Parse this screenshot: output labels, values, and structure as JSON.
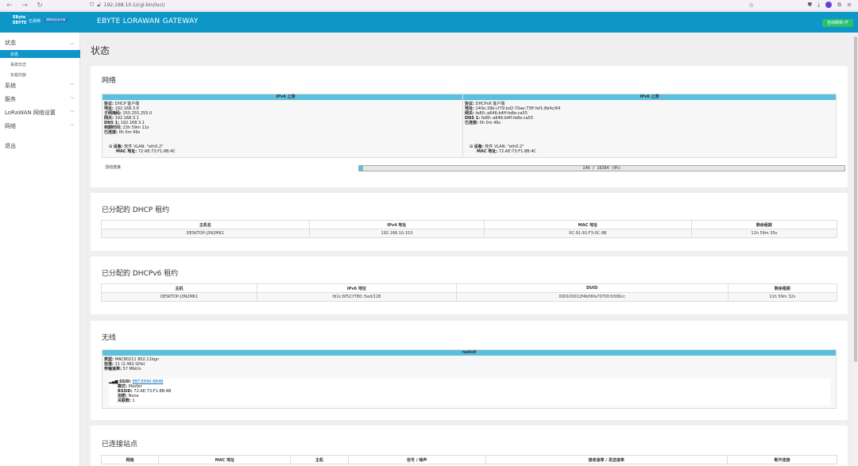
{
  "browser": {
    "url": "192.168.10.1/cgi-bin/luci/"
  },
  "header": {
    "logo_line1": "EByte",
    "logo_line2": "EBYTE",
    "logo_cn": "亿佰特",
    "logo_badge": "物联网应用专家",
    "title": "EBYTE LORAWAN GATEWAY",
    "auto_refresh": "自动刷新:开"
  },
  "sidebar": {
    "status": "状态",
    "status_items": [
      "状态",
      "系统日志",
      "负载均衡"
    ],
    "system": "系统",
    "services": "服务",
    "lorawan": "LoRaWAN 网络设置",
    "network": "网络",
    "logout": "退出"
  },
  "page_title": "状态",
  "network": {
    "title": "网络",
    "ipv4": {
      "header": "IPv4 上游",
      "lines": [
        {
          "k": "协议:",
          "v": "DHCP 客户端"
        },
        {
          "k": "地址:",
          "v": "192.168.3.8"
        },
        {
          "k": "子网掩码:",
          "v": "255.255.255.0"
        },
        {
          "k": "网关:",
          "v": "192.168.3.1"
        },
        {
          "k": "DNS 1:",
          "v": "192.168.3.1"
        },
        {
          "k": "到期时间:",
          "v": "23h 59m 11s"
        },
        {
          "k": "已连接:",
          "v": "0h 0m 49s"
        }
      ],
      "device_label": "设备:",
      "device_value": "软件 VLAN: \"eth0.2\"",
      "mac_label": "MAC 地址:",
      "mac_value": "72:AE:73:F1:8B:4C"
    },
    "ipv6": {
      "header": "IPv6 上游",
      "lines": [
        {
          "k": "协议:",
          "v": "DHCPv6 客户端"
        },
        {
          "k": "地址:",
          "v": "240e:39b:cf79:bd2:70ae:73ff:fef1:8b4c/64"
        },
        {
          "k": "网关:",
          "v": "fe80::a646:b4ff:fe8e:ca55"
        },
        {
          "k": "DNS 1:",
          "v": "fe80::a646:b4ff:fe8e:ca55"
        },
        {
          "k": "已连接:",
          "v": "0h 0m 46s"
        }
      ],
      "device_label": "设备:",
      "device_value": "软件 VLAN: \"eth0.2\"",
      "mac_label": "MAC 地址:",
      "mac_value": "72:AE:73:F1:8B:4C"
    },
    "active_conn_label": "活动连接",
    "active_conn_value": "149 / 16384 (0%)",
    "active_conn_fraction": 0.009
  },
  "dhcp": {
    "title": "已分配的 DHCP 租约",
    "columns": [
      "主机名",
      "IPv4 地址",
      "MAC 地址",
      "剩余租期"
    ],
    "rows": [
      [
        "DESKTOP-J3N2MK1",
        "192.168.10.153",
        "0C:91:92:F3:0C:9B",
        "11h 59m 35s"
      ]
    ]
  },
  "dhcpv6": {
    "title": "已分配的 DHCPv6 租约",
    "columns": [
      "主机",
      "IPv6 地址",
      "DUID",
      "剩余租期"
    ],
    "rows": [
      [
        "DESKTOP-J3N2MK1",
        "fd1c:6f52:f780::5ed/128",
        "000100012f4b06fa7070fc0306cc",
        "11h 59m 32s"
      ]
    ]
  },
  "wireless": {
    "title": "无线",
    "header": "radio0",
    "lines": [
      {
        "k": "类型:",
        "v": "MAC80211 802.11bgn"
      },
      {
        "k": "信道:",
        "v": "11 (2.462 GHz)"
      },
      {
        "k": "传输速率:",
        "v": "57 Mbit/s"
      }
    ],
    "ssid_label": "SSID:",
    "ssid_value": "EBT-E890-8B4B",
    "details": [
      {
        "k": "模式:",
        "v": "Master"
      },
      {
        "k": "BSSID:",
        "v": "72:AE:73:F1:8B:4B"
      },
      {
        "k": "加密:",
        "v": "None"
      },
      {
        "k": "关联数:",
        "v": "1"
      }
    ]
  },
  "stations": {
    "title": "已连接站点",
    "columns": [
      "网络",
      "MAC 地址",
      "主机",
      "信号 / 噪声",
      "接收速率 / 发送速率",
      "断开连接"
    ]
  }
}
